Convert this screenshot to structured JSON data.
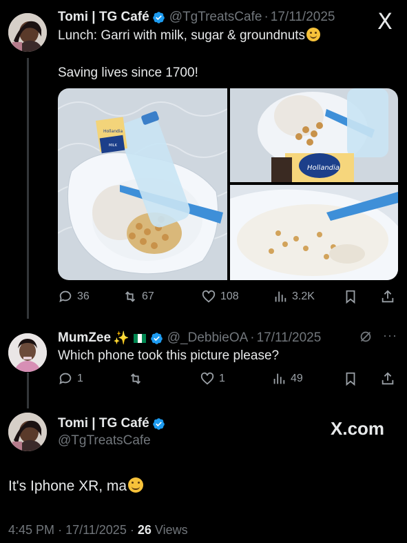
{
  "tweet1": {
    "name": "Tomi | TG Café",
    "handle": "@TgTreatsCafe",
    "date": "17/11/2025",
    "line1": "Lunch: Garri with milk, sugar & groundnuts",
    "line2": "Saving lives since 1700!",
    "media_brand_1": "Hollandia",
    "media_brand_2": "MILK",
    "media_brand_3": "Hollandia",
    "stats": {
      "replies": "36",
      "reposts": "67",
      "likes": "108",
      "views": "3.2K"
    }
  },
  "reply": {
    "name": "MumZee",
    "handle": "@_DebbieOA",
    "date": "17/11/2025",
    "text": "Which phone took this picture please?",
    "stats": {
      "replies": "1",
      "reposts": "",
      "likes": "1",
      "views": "49"
    }
  },
  "tweet2": {
    "name": "Tomi | TG Café",
    "handle": "@TgTreatsCafe",
    "text": "It's Iphone XR, ma",
    "time": "4:45 PM",
    "date": "17/11/2025",
    "views_count": "26",
    "views_label": "Views"
  },
  "top_logo": "X",
  "brand": "X.com",
  "sep": "·",
  "more": "···",
  "colors": {
    "verified": "#1d9bf0",
    "muted": "#71767b",
    "text": "#e7e9ea"
  },
  "icons": [
    "x-logo-icon",
    "verified-icon",
    "reply-icon",
    "repost-icon",
    "like-icon",
    "views-icon",
    "bookmark-icon",
    "share-icon",
    "grok-icon",
    "more-icon",
    "flag-icon",
    "sparkle-icon",
    "smile-emoji-icon"
  ]
}
